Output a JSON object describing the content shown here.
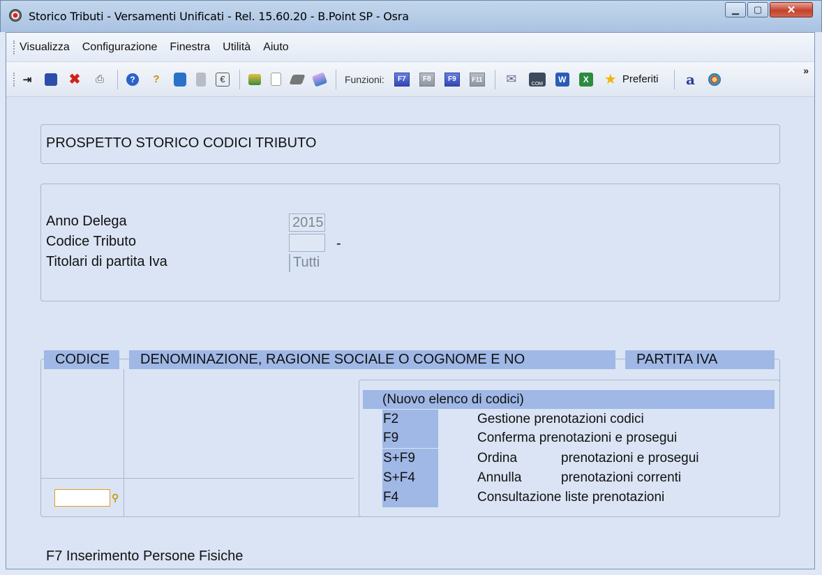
{
  "window": {
    "title": "Storico Tributi - Versamenti Unificati - Rel. 15.60.20 - B.Point SP - Osra",
    "minimize": "▁",
    "maximize": "▢",
    "close": "✕"
  },
  "menu": [
    "Visualizza",
    "Configurazione",
    "Finestra",
    "Utilità",
    "Aiuto"
  ],
  "toolbar": {
    "funzioni_label": "Funzioni:",
    "fkeys": [
      "F7",
      "F8",
      "F9",
      "F11"
    ],
    "preferiti": "Preferiti",
    "overflow": "»"
  },
  "header": {
    "title": "PROSPETTO STORICO CODICI TRIBUTO"
  },
  "filters": {
    "anno_label": "Anno Delega",
    "anno_value": "2015",
    "codice_label": "Codice Tributo",
    "codice_value": "",
    "codice_dash": "-",
    "titolari_label": "Titolari di partita Iva",
    "titolari_value": "Tutti"
  },
  "table": {
    "columns": [
      "CODICE",
      "DENOMINAZIONE, RAGIONE SOCIALE O COGNOME E NO",
      "PARTITA IVA"
    ]
  },
  "popup": {
    "title": "(Nuovo elenco di codici)",
    "rows": [
      {
        "key": "F2",
        "text": "Gestione prenotazioni codici",
        "text2": ""
      },
      {
        "key": "F9",
        "text": "Conferma prenotazioni e prosegui",
        "text2": ""
      },
      {
        "key": "S+F9",
        "text": "Ordina",
        "text2": "prenotazioni e prosegui"
      },
      {
        "key": "S+F4",
        "text": "Annulla",
        "text2": "prenotazioni correnti"
      },
      {
        "key": "F4",
        "text": "Consultazione liste prenotazioni",
        "text2": ""
      }
    ]
  },
  "footer": {
    "text": "F7 Inserimento Persone Fisiche"
  }
}
